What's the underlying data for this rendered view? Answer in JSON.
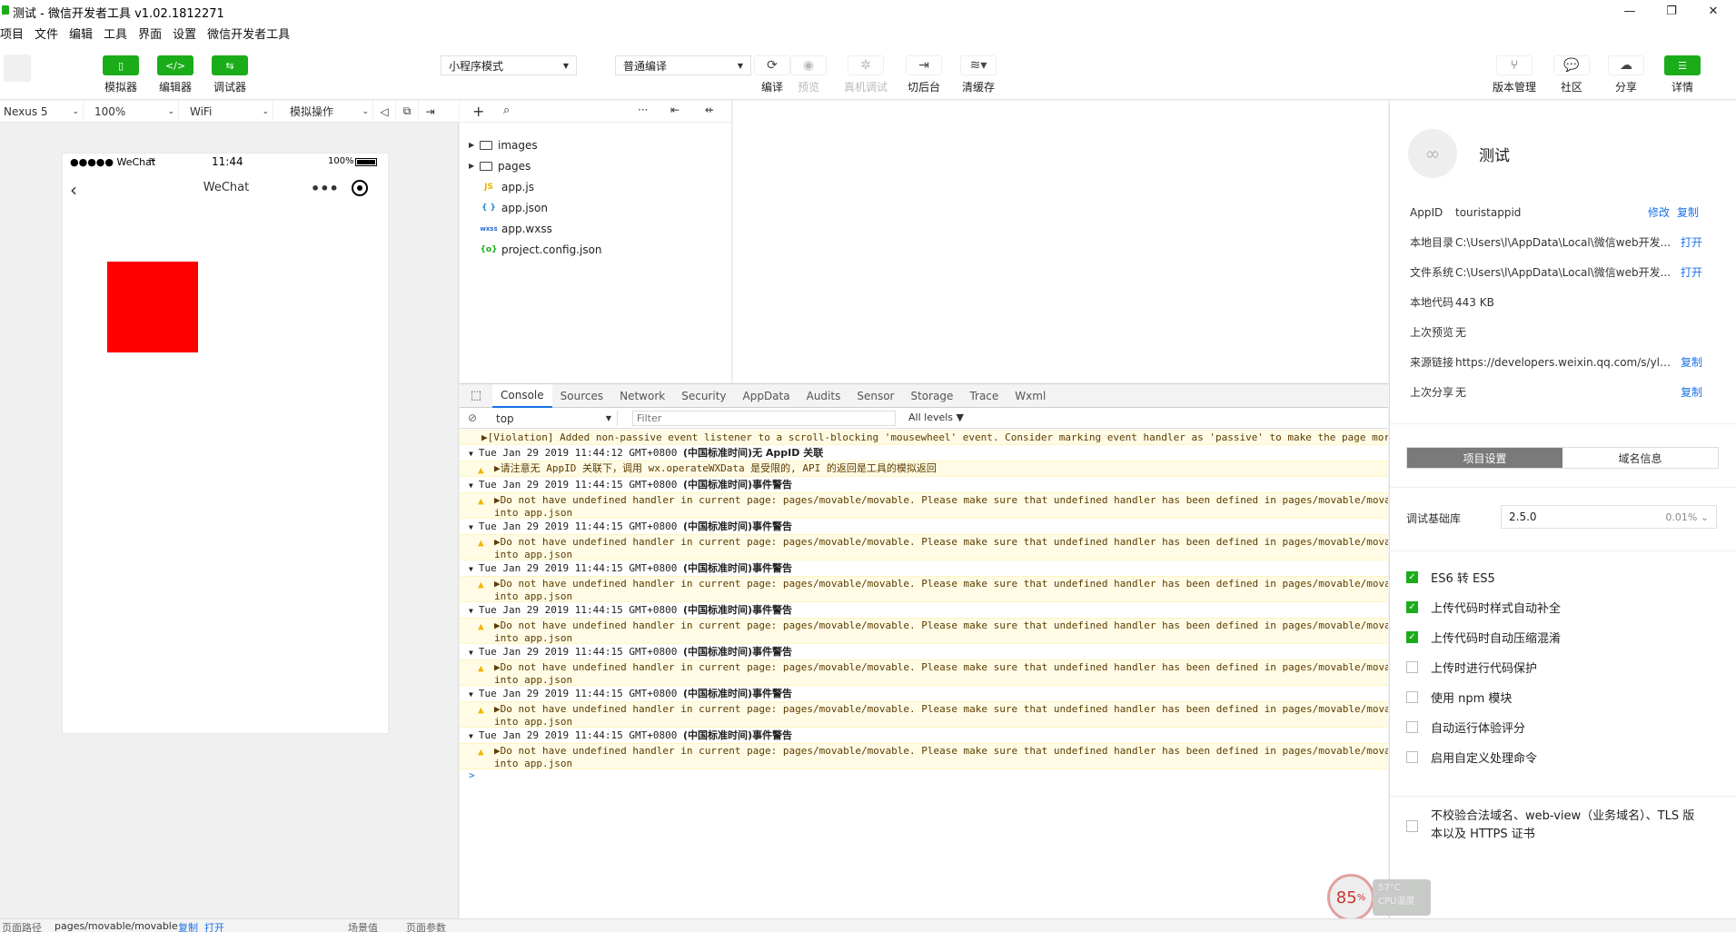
{
  "window": {
    "title": "测试 - 微信开发者工具 v1.02.1812271",
    "min": "—",
    "max": "❐",
    "close": "✕"
  },
  "menu": [
    "项目",
    "文件",
    "编辑",
    "工具",
    "界面",
    "设置",
    "微信开发者工具"
  ],
  "toolbar": {
    "simulator": "模拟器",
    "editor": "编辑器",
    "debugger": "调试器",
    "mode_select": "小程序模式",
    "compile_select": "普通编译",
    "compile": "编译",
    "preview": "预览",
    "remote_debug": "真机调试",
    "background": "切后台",
    "clear_cache": "清缓存",
    "version_mgmt": "版本管理",
    "community": "社区",
    "share": "分享",
    "details": "详情"
  },
  "simbar": {
    "device": "Nexus 5",
    "zoom": "100%",
    "network": "WiFi",
    "operation": "模拟操作"
  },
  "phone": {
    "carrier": "●●●●● WeChat",
    "time": "11:44",
    "battery": "100%",
    "nav_title": "WeChat"
  },
  "filetree": [
    {
      "type": "folder",
      "name": "images"
    },
    {
      "type": "folder",
      "name": "pages"
    },
    {
      "type": "js",
      "icon": "JS",
      "name": "app.js"
    },
    {
      "type": "json",
      "icon": "{ }",
      "name": "app.json"
    },
    {
      "type": "wxss",
      "icon": "wxss",
      "name": "app.wxss"
    },
    {
      "type": "config",
      "icon": "{o}",
      "name": "project.config.json"
    }
  ],
  "devtools": {
    "tabs": [
      "Console",
      "Sources",
      "Network",
      "Security",
      "AppData",
      "Audits",
      "Sensor",
      "Storage",
      "Trace",
      "Wxml"
    ],
    "context": "top",
    "filter_placeholder": "Filter",
    "levels": "All levels ▼",
    "violation": "▶[Violation] Added non-passive event listener to a scroll-blocking 'mousewheel' event. Consider marking event handler as 'passive' to make the page more",
    "groups": [
      {
        "ts": "Tue Jan 29 2019 11:44:12 GMT+0800",
        "tz": "(中国标准时间)",
        "label": "无 AppID 关联",
        "msg": "▶请注意无 AppID 关联下，调用 wx.operateWXData 是受限的, API 的返回是工具的模拟返回"
      },
      {
        "ts": "Tue Jan 29 2019 11:44:15 GMT+0800",
        "tz": "(中国标准时间)",
        "label": "事件警告",
        "msg": "▶Do not have undefined handler in current page: pages/movable/movable. Please make sure that undefined handler has been defined in pages/movable/mova\ninto app.json"
      },
      {
        "ts": "Tue Jan 29 2019 11:44:15 GMT+0800",
        "tz": "(中国标准时间)",
        "label": "事件警告",
        "msg": "▶Do not have undefined handler in current page: pages/movable/movable. Please make sure that undefined handler has been defined in pages/movable/mova\ninto app.json"
      },
      {
        "ts": "Tue Jan 29 2019 11:44:15 GMT+0800",
        "tz": "(中国标准时间)",
        "label": "事件警告",
        "msg": "▶Do not have undefined handler in current page: pages/movable/movable. Please make sure that undefined handler has been defined in pages/movable/mova\ninto app.json"
      },
      {
        "ts": "Tue Jan 29 2019 11:44:15 GMT+0800",
        "tz": "(中国标准时间)",
        "label": "事件警告",
        "msg": "▶Do not have undefined handler in current page: pages/movable/movable. Please make sure that undefined handler has been defined in pages/movable/mova\ninto app.json"
      },
      {
        "ts": "Tue Jan 29 2019 11:44:15 GMT+0800",
        "tz": "(中国标准时间)",
        "label": "事件警告",
        "msg": "▶Do not have undefined handler in current page: pages/movable/movable. Please make sure that undefined handler has been defined in pages/movable/mova\ninto app.json"
      },
      {
        "ts": "Tue Jan 29 2019 11:44:15 GMT+0800",
        "tz": "(中国标准时间)",
        "label": "事件警告",
        "msg": "▶Do not have undefined handler in current page: pages/movable/movable. Please make sure that undefined handler has been defined in pages/movable/mova\ninto app.json"
      },
      {
        "ts": "Tue Jan 29 2019 11:44:15 GMT+0800",
        "tz": "(中国标准时间)",
        "label": "事件警告",
        "msg": "▶Do not have undefined handler in current page: pages/movable/movable. Please make sure that undefined handler has been defined in pages/movable/mova\ninto app.json"
      }
    ],
    "prompt": ">"
  },
  "project": {
    "name": "测试",
    "rows": [
      {
        "key": "AppID",
        "value": "touristappid",
        "links": [
          "修改",
          "复制"
        ]
      },
      {
        "key": "本地目录",
        "value": "C:\\Users\\l\\AppData\\Local\\微信web开发...",
        "links": [
          "打开"
        ]
      },
      {
        "key": "文件系统",
        "value": "C:\\Users\\l\\AppData\\Local\\微信web开发...",
        "links": [
          "打开"
        ]
      },
      {
        "key": "本地代码",
        "value": "443 KB",
        "links": []
      },
      {
        "key": "上次预览",
        "value": "无",
        "links": []
      },
      {
        "key": "来源链接",
        "value": "https://developers.weixin.qq.com/s/ylSh...",
        "links": [
          "复制"
        ]
      },
      {
        "key": "上次分享",
        "value": "无",
        "links": [
          "复制"
        ]
      }
    ],
    "tab_settings": "项目设置",
    "tab_domain": "域名信息",
    "base_lib_label": "调试基础库",
    "base_lib_version": "2.5.0",
    "base_lib_share": "0.01%",
    "checks": [
      {
        "label": "ES6 转 ES5",
        "on": true
      },
      {
        "label": "上传代码时样式自动补全",
        "on": true
      },
      {
        "label": "上传代码时自动压缩混淆",
        "on": true
      },
      {
        "label": "上传时进行代码保护",
        "on": false
      },
      {
        "label": "使用 npm 模块",
        "on": false
      },
      {
        "label": "自动运行体验评分",
        "on": false
      },
      {
        "label": "启用自定义处理命令",
        "on": false
      }
    ],
    "domain_check_line1": "不校验合法域名、web-view（业务域名）、TLS 版",
    "domain_check_line2": "本以及 HTTPS 证书"
  },
  "bottombar": {
    "path_label": "页面路径",
    "path": "pages/movable/movable",
    "copy": "复制",
    "open": "打开",
    "scene": "场景值",
    "params": "页面参数"
  },
  "cpu": {
    "percent": "85",
    "unit": "%",
    "temp": "57°C",
    "label": "CPU温度"
  },
  "colors": {
    "accent_green": "#1aad19",
    "link_blue": "#1a73e8",
    "warn_bg": "#fffbe5"
  }
}
